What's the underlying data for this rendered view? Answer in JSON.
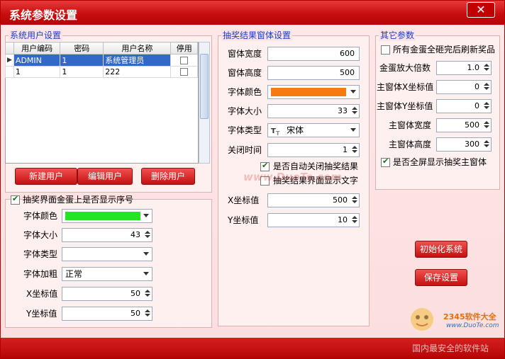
{
  "window": {
    "title": "系统参数设置",
    "close_label": "✕"
  },
  "users": {
    "title": "系统用户设置",
    "columns": [
      "用户编码",
      "密码",
      "用户名称",
      "停用"
    ],
    "rows": [
      {
        "code": "ADMIN",
        "password": "1",
        "name": "系统管理员",
        "disabled": false
      },
      {
        "code": "1",
        "password": "1",
        "name": "222",
        "disabled": false
      }
    ],
    "buttons": {
      "add": "新建用户",
      "edit": "编辑用户",
      "delete": "删除用户"
    }
  },
  "egg_number": {
    "checkbox_label": "抽奖界面金蛋上是否显示序号",
    "checked": true,
    "font_color_label": "字体颜色",
    "font_color": "#22e622",
    "font_size_label": "字体大小",
    "font_size": "43",
    "font_type_label": "字体类型",
    "font_type": "",
    "font_bold_label": "字体加粗",
    "font_bold": "正常",
    "x_label": "X坐标值",
    "x": "50",
    "y_label": "Y坐标值",
    "y": "50"
  },
  "result_window": {
    "title": "抽奖结果窗体设置",
    "width_label": "窗体宽度",
    "width": "600",
    "height_label": "窗体高度",
    "height": "500",
    "font_color_label": "字体颜色",
    "font_color": "#f57a10",
    "font_size_label": "字体大小",
    "font_size": "33",
    "font_type_label": "字体类型",
    "font_type": "宋体",
    "close_time_label": "关闭时间",
    "close_time": "1",
    "auto_close_label": "是否自动关闭抽奖结果",
    "auto_close": true,
    "show_text_label": "抽奖结果界面显示文字",
    "show_text": false,
    "x_label": "X坐标值",
    "x": "500",
    "y_label": "Y坐标值",
    "y": "10"
  },
  "other": {
    "title": "其它参数",
    "refresh_label": "所有金蛋全砸完后刷新奖品",
    "refresh": false,
    "zoom_label": "金蛋放大倍数",
    "zoom": "1.0",
    "main_x_label": "主窗体X坐标值",
    "main_x": "0",
    "main_y_label": "主窗体Y坐标值",
    "main_y": "0",
    "main_w_label": "主窗体宽度",
    "main_w": "500",
    "main_h_label": "主窗体高度",
    "main_h": "300",
    "fullscreen_label": "是否全屏显示抽奖主窗体",
    "fullscreen": true
  },
  "actions": {
    "init": "初始化系统",
    "save": "保存设置"
  },
  "branding": {
    "watermark": "www.DuoTe.com",
    "logo": "2345软件大全",
    "logo_url": "www.DuoTe.com",
    "footer": "国内最安全的软件站"
  }
}
